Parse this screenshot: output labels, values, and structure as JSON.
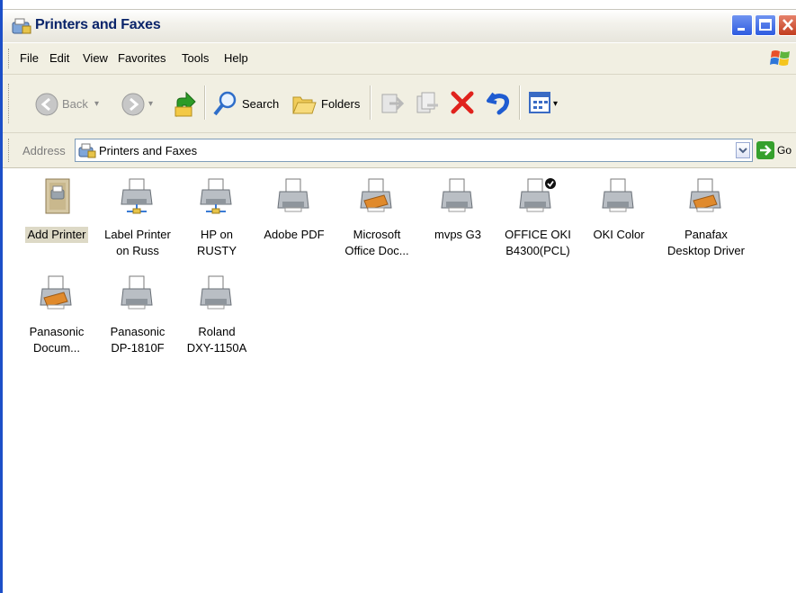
{
  "window": {
    "title": "Printers and Faxes"
  },
  "menu": [
    "File",
    "Edit",
    "View",
    "Favorites",
    "Tools",
    "Help"
  ],
  "toolbar": {
    "back_label": "Back",
    "search_label": "Search",
    "folders_label": "Folders"
  },
  "address": {
    "label": "Address",
    "value": "Printers and Faxes",
    "go_label": "Go"
  },
  "items": [
    {
      "label": "Add Printer",
      "icon": "add-printer-icon",
      "selected": true
    },
    {
      "label": "Label Printer\non Russ",
      "icon": "network-printer-icon"
    },
    {
      "label": "HP on RUSTY",
      "icon": "network-printer-icon"
    },
    {
      "label": "Adobe PDF",
      "icon": "printer-icon"
    },
    {
      "label": "Microsoft\nOffice Doc...",
      "icon": "fax-printer-icon"
    },
    {
      "label": "mvps G3",
      "icon": "printer-icon"
    },
    {
      "label": "OFFICE OKI\nB4300(PCL)",
      "icon": "default-printer-icon"
    },
    {
      "label": "OKI Color",
      "icon": "printer-icon"
    },
    {
      "label": "Panafax\nDesktop Driver",
      "icon": "fax-printer-icon"
    },
    {
      "label": "Panasonic\nDocum...",
      "icon": "fax-printer-icon"
    },
    {
      "label": "Panasonic\nDP-1810F",
      "icon": "printer-icon"
    },
    {
      "label": "Roland\nDXY-1150A",
      "icon": "printer-icon"
    }
  ],
  "colors": {
    "titlebar_text": "#0a246a",
    "chrome": "#f1efe2",
    "selection": "#ddd9c6",
    "close_button": "#c23c1e"
  }
}
